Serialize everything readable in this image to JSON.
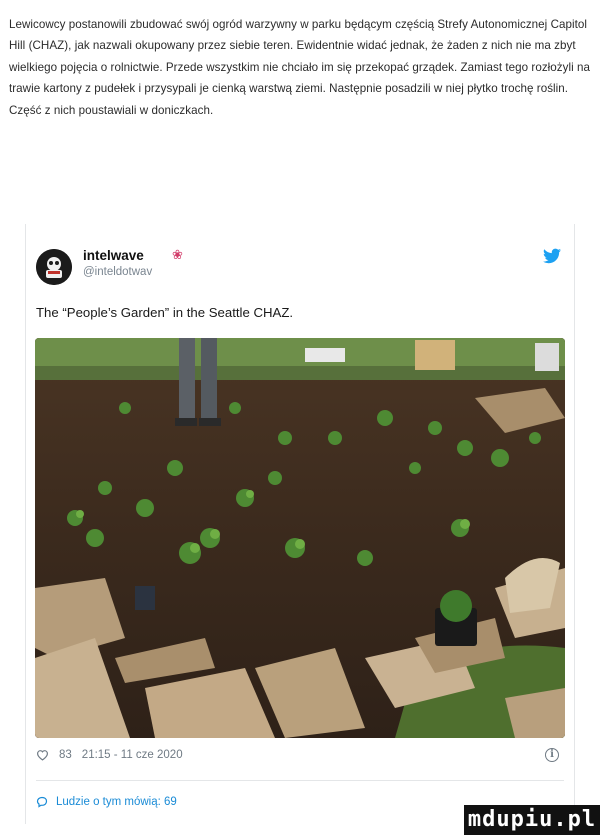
{
  "article": {
    "text": "Lewicowcy postanowili zbudować swój ogród warzywny w parku będącym częścią Strefy Autonomicznej Capitol Hill (CHAZ), jak nazwali okupowany przez siebie teren. Ewidentnie widać jednak, że żaden z nich nie ma zbyt wielkiego pojęcia o rolnictwie. Przede wszystkim nie chciało im się przekopać grządek. Zamiast tego rozłożyli na trawie kartony z pudełek i przysypali je cienką warstwą ziemi. Następnie posadzili w niej płytko trochę roślin. Część z nich poustawiali w doniczkach."
  },
  "tweet": {
    "author_name": "intelwave",
    "author_emoji": "❀",
    "handle": "@inteldotwav",
    "text": "The “People’s Garden” in the Seattle CHAZ.",
    "likes": "83",
    "timestamp": "21:15 - 11 cze 2020",
    "replies_label": "Ludzie o tym mówią: 69",
    "icons": {
      "platform": "twitter-bird-icon",
      "like": "heart-icon",
      "info": "info-icon",
      "replies": "speech-bubble-icon"
    },
    "accent_color": "#1da1f2"
  },
  "watermark": "mdupiu.pl"
}
